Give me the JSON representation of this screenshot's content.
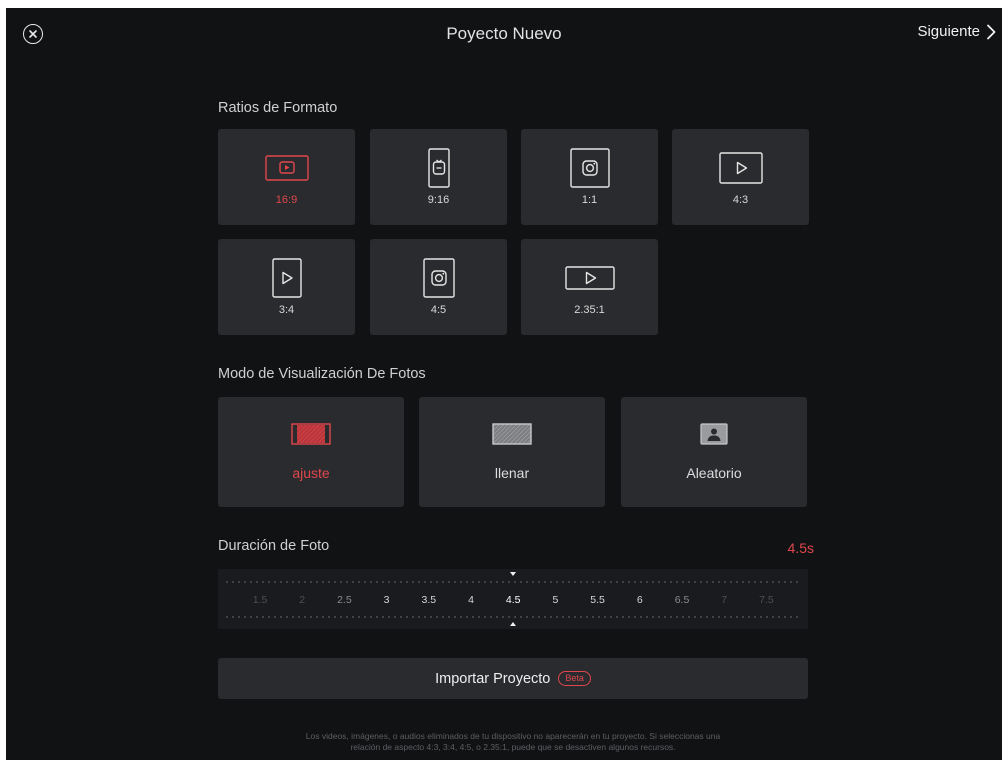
{
  "header": {
    "title": "Poyecto Nuevo",
    "next_label": "Siguiente"
  },
  "ratios": {
    "label": "Ratios de Formato",
    "items": [
      {
        "label": "16:9",
        "icon": "youtube-landscape-icon",
        "selected": true
      },
      {
        "label": "9:16",
        "icon": "tiktok-portrait-icon",
        "selected": false
      },
      {
        "label": "1:1",
        "icon": "instagram-square-icon",
        "selected": false
      },
      {
        "label": "4:3",
        "icon": "play-landscape-icon",
        "selected": false
      },
      {
        "label": "3:4",
        "icon": "play-portrait-icon",
        "selected": false
      },
      {
        "label": "4:5",
        "icon": "instagram-portrait-icon",
        "selected": false
      },
      {
        "label": "2.35:1",
        "icon": "play-wide-icon",
        "selected": false
      }
    ]
  },
  "photo_mode": {
    "label": "Modo de Visualización De Fotos",
    "items": [
      {
        "label": "ajuste",
        "icon": "fit-icon",
        "selected": true
      },
      {
        "label": "llenar",
        "icon": "fill-icon",
        "selected": false
      },
      {
        "label": "Aleatorio",
        "icon": "random-photo-icon",
        "selected": false
      }
    ]
  },
  "duration": {
    "label": "Duración de Foto",
    "value": "4.5s",
    "ticks": [
      "1.5",
      "2",
      "2.5",
      "3",
      "3.5",
      "4",
      "4.5",
      "5",
      "5.5",
      "6",
      "6.5",
      "7",
      "7.5"
    ],
    "selected_index": 6
  },
  "import": {
    "label": "Importar Proyecto",
    "badge": "Beta"
  },
  "footnote": {
    "line1": "Los videos, imágenes, o audios eliminados de tu dispositivo no aparecerán en tu proyecto. Si seleccionas  una",
    "line2": "relación de aspecto 4:3, 3:4, 4:5, o 2.35:1, puede que se desactiven algunos recursos."
  },
  "colors": {
    "accent": "#e0474c",
    "background": "#111214",
    "tile": "#2a2b2e"
  }
}
